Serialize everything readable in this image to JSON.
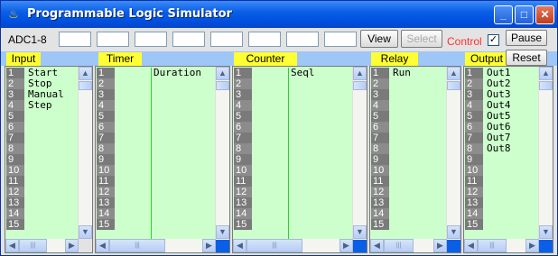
{
  "window": {
    "title": "Programmable Logic Simulator",
    "icon": "java-coffee-icon",
    "controls": {
      "minimize": "_",
      "maximize": "□",
      "close": "✕"
    }
  },
  "toolbar": {
    "adc_label": "ADC1-8",
    "adc_values": [
      "",
      "",
      "",
      "",
      "",
      "",
      "",
      ""
    ],
    "view_label": "View",
    "select_label": "Select",
    "control_label": "Control",
    "control_checked": "✓",
    "pause_label": "Pause",
    "reset_label": "Reset"
  },
  "panels": {
    "input": {
      "label": "Input",
      "items": [
        "Start",
        "Stop",
        "Manual",
        "Step"
      ]
    },
    "timer": {
      "label": "Timer",
      "header": "Duration"
    },
    "counter": {
      "label": "Counter",
      "header": "Seql"
    },
    "relay": {
      "label": "Relay",
      "items": [
        "Run"
      ]
    },
    "output": {
      "label": "Output",
      "items": [
        "Out1",
        "Out2",
        "Out3",
        "Out4",
        "Out5",
        "Out6",
        "Out7",
        "Out8"
      ]
    }
  },
  "row_numbers": [
    "1",
    "2",
    "3",
    "4",
    "5",
    "6",
    "7",
    "8",
    "9",
    "10",
    "11",
    "12",
    "13",
    "14",
    "15"
  ],
  "scroll": {
    "up": "▲",
    "down": "▼",
    "left": "◀",
    "right": "▶",
    "grip": "|||"
  }
}
